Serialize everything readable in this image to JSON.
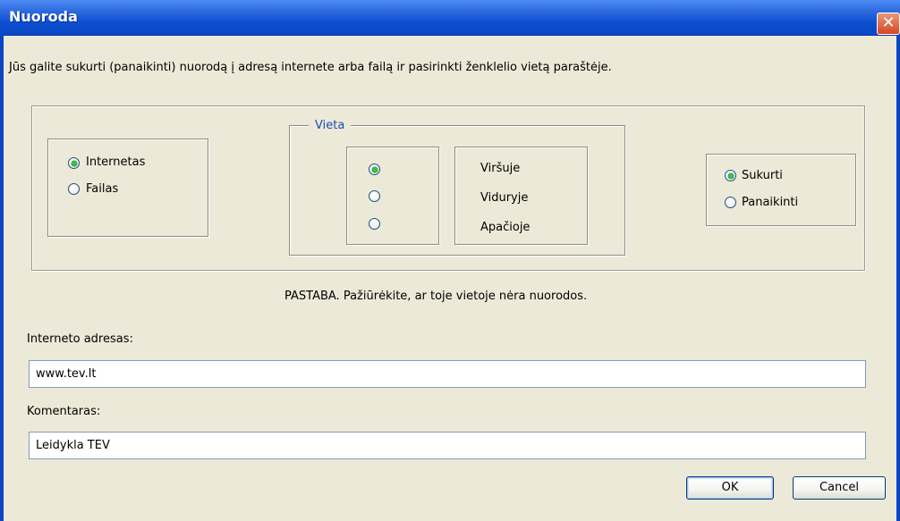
{
  "window": {
    "title": "Nuoroda",
    "close_glyph": "✕"
  },
  "intro_text": "Jūs galite sukurti (panaikinti)  nuorodą į adresą internete arba failą ir pasirinkti ženklelio vietą paraštėje.",
  "type_group": {
    "options": [
      {
        "label": "Internetas",
        "checked": true
      },
      {
        "label": "Failas",
        "checked": false
      }
    ]
  },
  "vieta_group": {
    "legend": "Vieta",
    "options": [
      {
        "label": "Viršuje",
        "checked": true
      },
      {
        "label": "Viduryje",
        "checked": false
      },
      {
        "label": "Apačioje",
        "checked": false
      }
    ]
  },
  "action_group": {
    "options": [
      {
        "label": "Sukurti",
        "checked": true
      },
      {
        "label": "Panaikinti",
        "checked": false
      }
    ]
  },
  "note": "PASTABA. Pažiūrėkite, ar toje vietoje nėra nuorodos.",
  "address": {
    "label": "Interneto adresas:",
    "value": "www.tev.lt"
  },
  "comment": {
    "label": "Komentaras:",
    "value": "Leidykla TEV"
  },
  "buttons": {
    "ok": "OK",
    "cancel": "Cancel"
  },
  "colors": {
    "titlebar": "#0b4fd0",
    "dialog_bg": "#ece9d8",
    "radio_checked": "#3ac04a",
    "legend_text": "#1b4db4"
  }
}
